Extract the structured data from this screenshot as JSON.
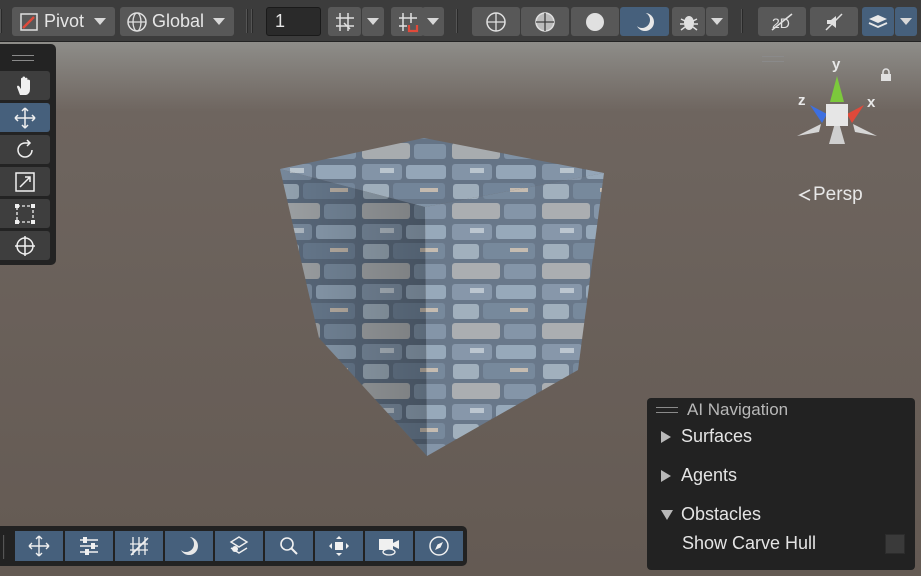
{
  "toolbar": {
    "pivot_label": "Pivot",
    "space_label": "Global",
    "snap_value": "1"
  },
  "tools": {
    "items": [
      "hand",
      "move",
      "rotate",
      "scale",
      "rect",
      "transform"
    ],
    "active": "move"
  },
  "gizmo": {
    "x_label": "x",
    "y_label": "y",
    "z_label": "z",
    "projection_label": "Persp",
    "colors": {
      "x": "#e0493a",
      "y": "#7cc93c",
      "z": "#3d6fe0"
    }
  },
  "ai_navigation": {
    "title": "AI Navigation",
    "surfaces": "Surfaces",
    "agents": "Agents",
    "obstacles": "Obstacles",
    "show_carve_hull": "Show Carve Hull",
    "show_carve_hull_checked": false
  },
  "colors": {
    "active_button": "#46607c",
    "toolbar_bg": "#3c3c3c",
    "panel_bg": "#222222"
  }
}
